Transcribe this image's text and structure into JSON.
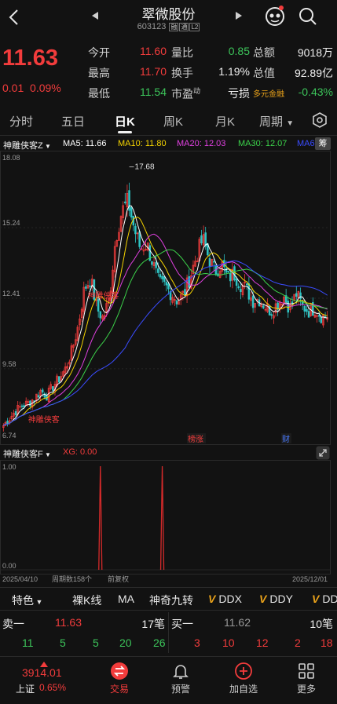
{
  "header": {
    "back_icon": "chevron-left-icon",
    "prev_icon": "triangle-left-icon",
    "next_icon": "triangle-right-icon",
    "stock_name": "翠微股份",
    "stock_code": "603123",
    "tags": [
      "融",
      "通",
      "L2"
    ],
    "robot_icon": "assistant-robot-icon",
    "search_icon": "search-icon"
  },
  "quote": {
    "price": "11.63",
    "change": "0.01",
    "change_pct": "0.09%",
    "open_label": "今开",
    "open_value": "11.60",
    "high_label": "最高",
    "high_value": "11.70",
    "low_label": "最低",
    "low_value": "11.54",
    "volume_ratio_label": "量比",
    "volume_ratio_value": "0.85",
    "turnover_label": "换手",
    "turnover_value": "1.19%",
    "pe_label": "市盈",
    "pe_sup": "动",
    "pe_value": "亏损",
    "amount_label": "总额",
    "amount_value": "9018万",
    "mcap_label": "总值",
    "mcap_value": "92.89亿",
    "fund_label": "多元金融",
    "fund_value": "-0.43%"
  },
  "tabs": {
    "items": [
      "分时",
      "五日",
      "日K",
      "周K",
      "月K",
      "周期"
    ],
    "active": "日K",
    "settings_icon": "hexagon-settings-icon"
  },
  "ma_row": {
    "indicator": "神雕侠客Z",
    "ma5": "MA5: 11.66",
    "ma10": "MA10: 11.80",
    "ma20": "MA20: 12.03",
    "ma30": "MA30: 12.07",
    "ma60": "MA6",
    "chip_button": "筹",
    "colors": {
      "ma5": "#ffffff",
      "ma10": "#f5d400",
      "ma20": "#e040e0",
      "ma30": "#3cd24a",
      "ma60": "#3a4cff"
    }
  },
  "kline": {
    "axis_labels": [
      "18.08",
      "15.24",
      "12.41",
      "9.58",
      "6.74"
    ],
    "high_marker": "17.68",
    "signal_label": "神雕侠客",
    "event_tags": [
      "榜涨",
      "财"
    ]
  },
  "subchart": {
    "indicator": "神雕侠客F",
    "xg_label": "XG: 0.00",
    "y_top": "1.00",
    "y_bottom": "0.00",
    "date_start": "2025/04/10",
    "period_count": "周期数158个",
    "adjust": "前复权",
    "date_end": "2025/12/01",
    "expand_icon": "expand-icon"
  },
  "tools": {
    "items": [
      "特色",
      "裸K线",
      "MA",
      "神奇九转",
      "DDX",
      "DDY",
      "DD"
    ],
    "feature_dropdown_icon": "triangle-down-icon"
  },
  "order_book": {
    "sell_label": "卖一",
    "sell_price": "11.63",
    "sell_qty": "17笔",
    "buy_label": "买一",
    "buy_price": "11.62",
    "buy_qty": "10笔",
    "sell_counts": [
      "11",
      "5",
      "5",
      "20",
      "26"
    ],
    "buy_counts": [
      "3",
      "10",
      "12",
      "2",
      "18"
    ]
  },
  "bottom_bar": {
    "index_value": "3914.01",
    "index_name": "上证",
    "index_change": "0.65%",
    "nav": [
      "交易",
      "预警",
      "加自选",
      "更多"
    ]
  },
  "chart_data": {
    "type": "candlestick",
    "title": "",
    "ylim": [
      6.74,
      18.08
    ],
    "x_range": [
      "2025/04/10",
      "2025/12/01"
    ],
    "period_count": 158,
    "high_marker": 17.68,
    "last_close": 11.63,
    "ma_last": {
      "MA5": 11.66,
      "MA10": 11.8,
      "MA20": 12.03,
      "MA30": 12.07
    },
    "close_trajectory": [
      7.3,
      7.6,
      7.9,
      8.1,
      8.2,
      8.4,
      8.7,
      8.5,
      8.9,
      9.2,
      9.6,
      10.3,
      11.3,
      12.8,
      13.2,
      12.0,
      11.6,
      12.4,
      14.8,
      15.9,
      16.3,
      15.2,
      14.4,
      14.6,
      13.8,
      13.0,
      12.9,
      12.6,
      12.3,
      12.6,
      13.3,
      14.1,
      14.8,
      14.0,
      13.5,
      13.8,
      13.2,
      13.4,
      13.0,
      12.8,
      12.3,
      12.4,
      12.1,
      11.9,
      12.2,
      12.5,
      12.0,
      12.6,
      12.1,
      11.9,
      12.0,
      11.7,
      11.63
    ]
  }
}
